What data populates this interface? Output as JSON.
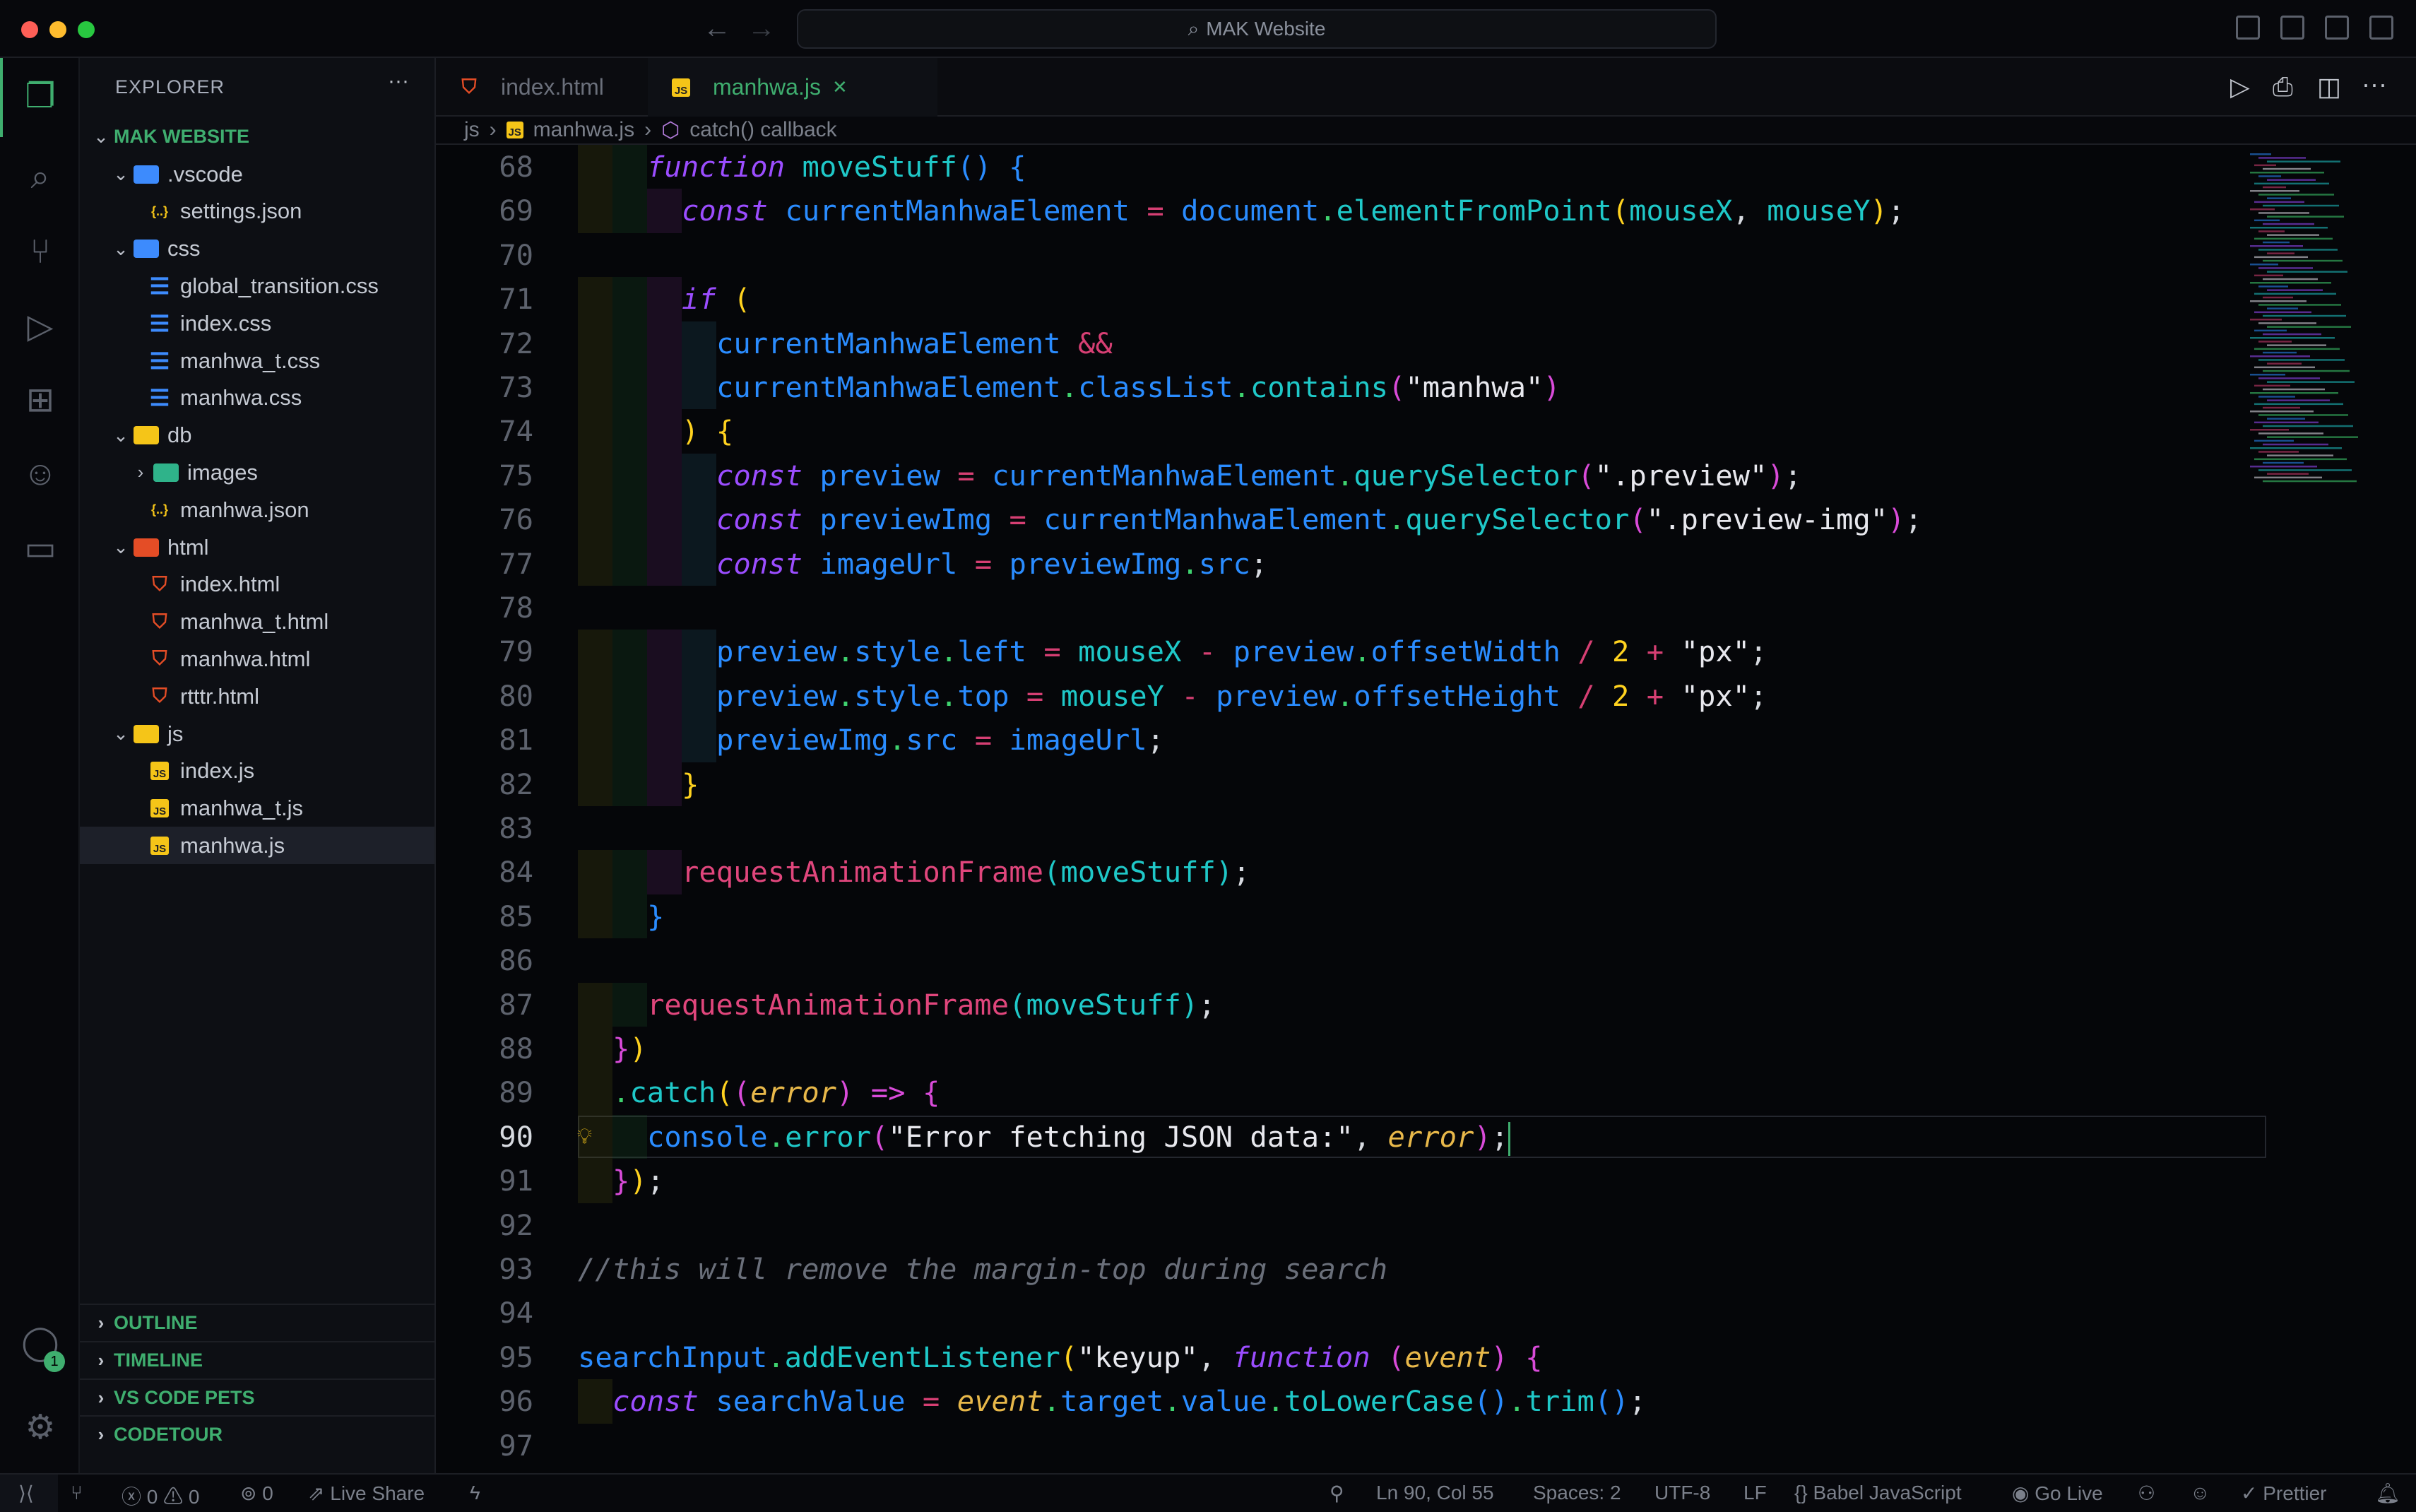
{
  "window": {
    "title": "MAK Website",
    "search_icon": "search-icon"
  },
  "explorer": {
    "title": "EXPLORER",
    "more": "···",
    "root": "MAK WEBSITE",
    "items": [
      {
        "label": ".vscode",
        "type": "folder",
        "depth": 1,
        "color": "#3d8bfd",
        "open": true
      },
      {
        "label": "settings.json",
        "type": "json",
        "depth": 2
      },
      {
        "label": "css",
        "type": "folder",
        "depth": 1,
        "color": "#3d8bfd",
        "open": true
      },
      {
        "label": "global_transition.css",
        "type": "css",
        "depth": 2
      },
      {
        "label": "index.css",
        "type": "css",
        "depth": 2
      },
      {
        "label": "manhwa_t.css",
        "type": "css",
        "depth": 2
      },
      {
        "label": "manhwa.css",
        "type": "css",
        "depth": 2
      },
      {
        "label": "db",
        "type": "folder",
        "depth": 1,
        "color": "#f5c518",
        "open": true
      },
      {
        "label": "images",
        "type": "folder",
        "depth": 2,
        "color": "#2fb38a",
        "open": false
      },
      {
        "label": "manhwa.json",
        "type": "json",
        "depth": 2
      },
      {
        "label": "html",
        "type": "folder",
        "depth": 1,
        "color": "#e44d26",
        "open": true
      },
      {
        "label": "index.html",
        "type": "html",
        "depth": 2
      },
      {
        "label": "manhwa_t.html",
        "type": "html",
        "depth": 2
      },
      {
        "label": "manhwa.html",
        "type": "html",
        "depth": 2
      },
      {
        "label": "rtttr.html",
        "type": "html",
        "depth": 2
      },
      {
        "label": "js",
        "type": "folder",
        "depth": 1,
        "color": "#f5c518",
        "open": true
      },
      {
        "label": "index.js",
        "type": "js",
        "depth": 2
      },
      {
        "label": "manhwa_t.js",
        "type": "js",
        "depth": 2
      },
      {
        "label": "manhwa.js",
        "type": "js",
        "depth": 2,
        "selected": true
      }
    ],
    "panels": [
      "OUTLINE",
      "TIMELINE",
      "VS CODE PETS",
      "CODETOUR"
    ]
  },
  "tabs": [
    {
      "label": "index.html",
      "icon": "html",
      "active": false
    },
    {
      "label": "manhwa.js",
      "icon": "js",
      "active": true,
      "close": "✕"
    }
  ],
  "breadcrumb": [
    "js",
    "manhwa.js",
    "catch() callback"
  ],
  "activity": {
    "badge": "1"
  },
  "editor": {
    "current_line": 90,
    "lines": [
      {
        "n": 68,
        "i": 2,
        "t": [
          [
            "function",
            "k"
          ],
          [
            " ",
            "p"
          ],
          [
            "moveStuff",
            "f"
          ],
          [
            "()",
            "b"
          ],
          [
            " ",
            "p"
          ],
          [
            "{",
            "b"
          ]
        ]
      },
      {
        "n": 69,
        "i": 3,
        "t": [
          [
            "const",
            "k"
          ],
          [
            " ",
            "p"
          ],
          [
            "currentManhwaElement",
            "v"
          ],
          [
            " = ",
            "o"
          ],
          [
            "document",
            "v"
          ],
          [
            ".",
            "g"
          ],
          [
            "elementFromPoint",
            "f"
          ],
          [
            "(",
            "y"
          ],
          [
            "mouseX",
            "f"
          ],
          [
            ", ",
            "p"
          ],
          [
            "mouseY",
            "f"
          ],
          [
            ")",
            "y"
          ],
          [
            ";",
            "p"
          ]
        ]
      },
      {
        "n": 70,
        "i": 0,
        "t": []
      },
      {
        "n": 71,
        "i": 3,
        "t": [
          [
            "if",
            "k"
          ],
          [
            " ",
            "p"
          ],
          [
            "(",
            "y"
          ]
        ]
      },
      {
        "n": 72,
        "i": 4,
        "t": [
          [
            "currentManhwaElement",
            "v"
          ],
          [
            " &&",
            "o"
          ]
        ]
      },
      {
        "n": 73,
        "i": 4,
        "t": [
          [
            "currentManhwaElement",
            "v"
          ],
          [
            ".",
            "g"
          ],
          [
            "classList",
            "v"
          ],
          [
            ".",
            "g"
          ],
          [
            "contains",
            "f"
          ],
          [
            "(",
            "m"
          ],
          [
            "\"manhwa\"",
            "s"
          ],
          [
            ")",
            "m"
          ]
        ]
      },
      {
        "n": 74,
        "i": 3,
        "t": [
          [
            ")",
            "y"
          ],
          [
            " ",
            "p"
          ],
          [
            "{",
            "y"
          ]
        ]
      },
      {
        "n": 75,
        "i": 4,
        "t": [
          [
            "const",
            "k"
          ],
          [
            " ",
            "p"
          ],
          [
            "preview",
            "v"
          ],
          [
            " = ",
            "o"
          ],
          [
            "currentManhwaElement",
            "v"
          ],
          [
            ".",
            "g"
          ],
          [
            "querySelector",
            "f"
          ],
          [
            "(",
            "m"
          ],
          [
            "\".preview\"",
            "s"
          ],
          [
            ")",
            "m"
          ],
          [
            ";",
            "p"
          ]
        ]
      },
      {
        "n": 76,
        "i": 4,
        "t": [
          [
            "const",
            "k"
          ],
          [
            " ",
            "p"
          ],
          [
            "previewImg",
            "v"
          ],
          [
            " = ",
            "o"
          ],
          [
            "currentManhwaElement",
            "v"
          ],
          [
            ".",
            "g"
          ],
          [
            "querySelector",
            "f"
          ],
          [
            "(",
            "m"
          ],
          [
            "\".preview-img\"",
            "s"
          ],
          [
            ")",
            "m"
          ],
          [
            ";",
            "p"
          ]
        ]
      },
      {
        "n": 77,
        "i": 4,
        "t": [
          [
            "const",
            "k"
          ],
          [
            " ",
            "p"
          ],
          [
            "imageUrl",
            "v"
          ],
          [
            " = ",
            "o"
          ],
          [
            "previewImg",
            "v"
          ],
          [
            ".",
            "g"
          ],
          [
            "src",
            "v"
          ],
          [
            ";",
            "p"
          ]
        ]
      },
      {
        "n": 78,
        "i": 0,
        "t": []
      },
      {
        "n": 79,
        "i": 4,
        "t": [
          [
            "preview",
            "v"
          ],
          [
            ".",
            "g"
          ],
          [
            "style",
            "v"
          ],
          [
            ".",
            "g"
          ],
          [
            "left",
            "v"
          ],
          [
            " = ",
            "o"
          ],
          [
            "mouseX",
            "f"
          ],
          [
            " - ",
            "o"
          ],
          [
            "preview",
            "v"
          ],
          [
            ".",
            "g"
          ],
          [
            "offsetWidth",
            "v"
          ],
          [
            " / ",
            "o"
          ],
          [
            "2",
            "y"
          ],
          [
            " + ",
            "o"
          ],
          [
            "\"px\"",
            "s"
          ],
          [
            ";",
            "p"
          ]
        ]
      },
      {
        "n": 80,
        "i": 4,
        "t": [
          [
            "preview",
            "v"
          ],
          [
            ".",
            "g"
          ],
          [
            "style",
            "v"
          ],
          [
            ".",
            "g"
          ],
          [
            "top",
            "v"
          ],
          [
            " = ",
            "o"
          ],
          [
            "mouseY",
            "f"
          ],
          [
            " - ",
            "o"
          ],
          [
            "preview",
            "v"
          ],
          [
            ".",
            "g"
          ],
          [
            "offsetHeight",
            "v"
          ],
          [
            " / ",
            "o"
          ],
          [
            "2",
            "y"
          ],
          [
            " + ",
            "o"
          ],
          [
            "\"px\"",
            "s"
          ],
          [
            ";",
            "p"
          ]
        ]
      },
      {
        "n": 81,
        "i": 4,
        "t": [
          [
            "previewImg",
            "v"
          ],
          [
            ".",
            "g"
          ],
          [
            "src",
            "v"
          ],
          [
            " = ",
            "o"
          ],
          [
            "imageUrl",
            "v"
          ],
          [
            ";",
            "p"
          ]
        ]
      },
      {
        "n": 82,
        "i": 3,
        "t": [
          [
            "}",
            "y"
          ]
        ]
      },
      {
        "n": 83,
        "i": 0,
        "t": []
      },
      {
        "n": 84,
        "i": 3,
        "t": [
          [
            "requestAnimationFrame",
            "r"
          ],
          [
            "(",
            "f"
          ],
          [
            "moveStuff",
            "f"
          ],
          [
            ")",
            "f"
          ],
          [
            ";",
            "p"
          ]
        ]
      },
      {
        "n": 85,
        "i": 2,
        "t": [
          [
            "}",
            "b"
          ]
        ]
      },
      {
        "n": 86,
        "i": 0,
        "t": []
      },
      {
        "n": 87,
        "i": 2,
        "t": [
          [
            "requestAnimationFrame",
            "r"
          ],
          [
            "(",
            "f"
          ],
          [
            "moveStuff",
            "f"
          ],
          [
            ")",
            "f"
          ],
          [
            ";",
            "p"
          ]
        ]
      },
      {
        "n": 88,
        "i": 1,
        "t": [
          [
            "}",
            "m"
          ],
          [
            ")",
            "y"
          ]
        ]
      },
      {
        "n": 89,
        "i": 1,
        "t": [
          [
            ".",
            "g"
          ],
          [
            "catch",
            "f"
          ],
          [
            "(",
            "y"
          ],
          [
            "(",
            "m"
          ],
          [
            "error",
            "pa"
          ],
          [
            ")",
            "m"
          ],
          [
            " => ",
            "m"
          ],
          [
            "{",
            "m"
          ]
        ]
      },
      {
        "n": 90,
        "i": 2,
        "t": [
          [
            "console",
            "v"
          ],
          [
            ".",
            "g"
          ],
          [
            "error",
            "f"
          ],
          [
            "(",
            "m"
          ],
          [
            "\"Error fetching JSON data:\"",
            "s"
          ],
          [
            ", ",
            "p"
          ],
          [
            "error",
            "pa"
          ],
          [
            ")",
            "m"
          ],
          [
            ";",
            "p"
          ]
        ]
      },
      {
        "n": 91,
        "i": 1,
        "t": [
          [
            "}",
            "m"
          ],
          [
            ")",
            "y"
          ],
          [
            ";",
            "p"
          ]
        ]
      },
      {
        "n": 92,
        "i": 0,
        "t": []
      },
      {
        "n": 93,
        "i": 0,
        "t": [
          [
            "//this will remove the margin-top during search",
            "c"
          ]
        ]
      },
      {
        "n": 94,
        "i": 0,
        "t": []
      },
      {
        "n": 95,
        "i": 0,
        "t": [
          [
            "searchInput",
            "v"
          ],
          [
            ".",
            "g"
          ],
          [
            "addEventListener",
            "f"
          ],
          [
            "(",
            "y"
          ],
          [
            "\"keyup\"",
            "s"
          ],
          [
            ", ",
            "p"
          ],
          [
            "function",
            "k"
          ],
          [
            " ",
            "p"
          ],
          [
            "(",
            "m"
          ],
          [
            "event",
            "pa"
          ],
          [
            ")",
            "m"
          ],
          [
            " ",
            "p"
          ],
          [
            "{",
            "m"
          ]
        ]
      },
      {
        "n": 96,
        "i": 1,
        "t": [
          [
            "const",
            "k"
          ],
          [
            " ",
            "p"
          ],
          [
            "searchValue",
            "v"
          ],
          [
            " = ",
            "o"
          ],
          [
            "event",
            "pa"
          ],
          [
            ".",
            "g"
          ],
          [
            "target",
            "v"
          ],
          [
            ".",
            "g"
          ],
          [
            "value",
            "v"
          ],
          [
            ".",
            "g"
          ],
          [
            "toLowerCase",
            "f"
          ],
          [
            "()",
            "b"
          ],
          [
            ".",
            "g"
          ],
          [
            "trim",
            "f"
          ],
          [
            "()",
            "b"
          ],
          [
            ";",
            "p"
          ]
        ]
      },
      {
        "n": 97,
        "i": 0,
        "t": []
      }
    ]
  },
  "status": {
    "errors": "0",
    "warnings": "0",
    "ports": "0",
    "live_share": "Live Share",
    "position": "Ln 90, Col 55",
    "spaces": "Spaces: 2",
    "encoding": "UTF-8",
    "eol": "LF",
    "language": "Babel JavaScript",
    "go_live": "Go Live",
    "prettier": "Prettier"
  }
}
